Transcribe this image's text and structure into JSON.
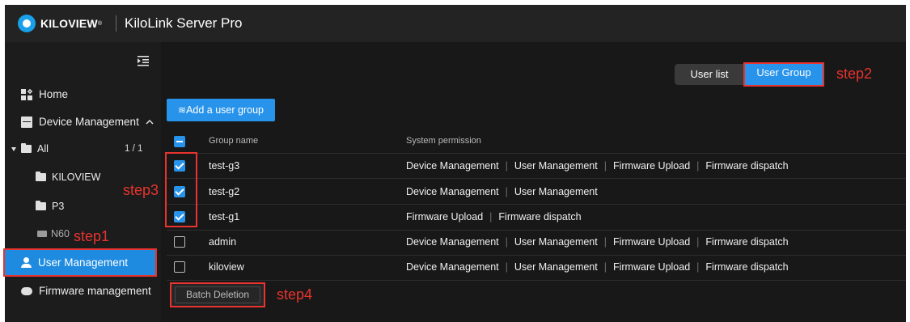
{
  "header": {
    "brand": "KILOVIEW",
    "brand_mark": "®",
    "title": "KiloLink Server Pro"
  },
  "sidebar": {
    "collapse_icon": "collapse-menu-icon",
    "home": "Home",
    "device_management": "Device Management",
    "folders": [
      {
        "label": "All",
        "count": "1 / 1"
      },
      {
        "label": "KILOVIEW"
      },
      {
        "label": "P3"
      }
    ],
    "device": "N60",
    "user_management": "User Management",
    "firmware_management": "Firmware management"
  },
  "tabs": {
    "user_list": "User list",
    "user_group": "User Group"
  },
  "toolbar": {
    "add_group": "Add a user group"
  },
  "table": {
    "headers": [
      "Group name",
      "System permission"
    ],
    "rows": [
      {
        "name": "test-g3",
        "checked": true,
        "permissions": [
          "Device Management",
          "User Management",
          "Firmware Upload",
          "Firmware dispatch"
        ]
      },
      {
        "name": "test-g2",
        "checked": true,
        "permissions": [
          "Device Management",
          "User Management"
        ]
      },
      {
        "name": "test-g1",
        "checked": true,
        "permissions": [
          "Firmware Upload",
          "Firmware dispatch"
        ]
      },
      {
        "name": "admin",
        "checked": false,
        "permissions": [
          "Device Management",
          "User Management",
          "Firmware Upload",
          "Firmware dispatch"
        ]
      },
      {
        "name": "kiloview",
        "checked": false,
        "permissions": [
          "Device Management",
          "User Management",
          "Firmware Upload",
          "Firmware dispatch"
        ]
      }
    ]
  },
  "footer": {
    "batch_delete": "Batch Deletion"
  },
  "annotations": {
    "step1": "step1",
    "step2": "step2",
    "step3": "step3",
    "step4": "step4"
  },
  "colors": {
    "accent": "#2793ea",
    "highlight": "#e8332e",
    "background": "#181818"
  }
}
